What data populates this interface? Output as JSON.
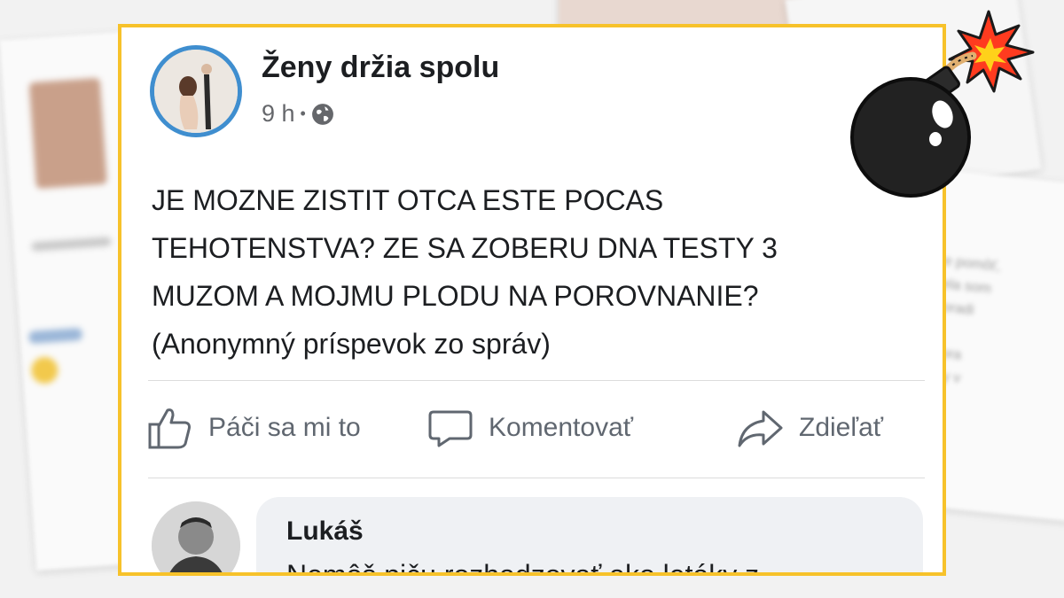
{
  "post": {
    "page_name": "Ženy držia spolu",
    "time": "9 h",
    "separator": "•",
    "audience_icon": "globe-icon",
    "text_lines": [
      "JE MOZNE ZISTIT OTCA ESTE POCAS",
      "TEHOTENSTVA? ZE SA ZOBERU DNA TESTY 3",
      "MUZOM A MOJMU PLODU NA POROVNANIE?",
      "(Anonymný príspevok zo správ)"
    ],
    "actions": {
      "like": {
        "label": "Páči sa mi to",
        "icon": "thumbs-up-icon"
      },
      "comment": {
        "label": "Komentovať",
        "icon": "comment-icon"
      },
      "share": {
        "label": "Zdieľať",
        "icon": "share-icon"
      }
    }
  },
  "comment": {
    "author": "Lukáš",
    "text": "Nemôš piču rozhadzovať ako letáky z"
  },
  "background_text": {
    "right_snippet": "re pomôť,\nrela som\nporadi\nk\nktora\naky v"
  },
  "colors": {
    "frame_border": "#f7c22a",
    "avatar_ring": "#3f8ecf",
    "comment_bg": "#eff1f4",
    "bomb_body": "#222222",
    "spark": "#ff3b1f"
  }
}
